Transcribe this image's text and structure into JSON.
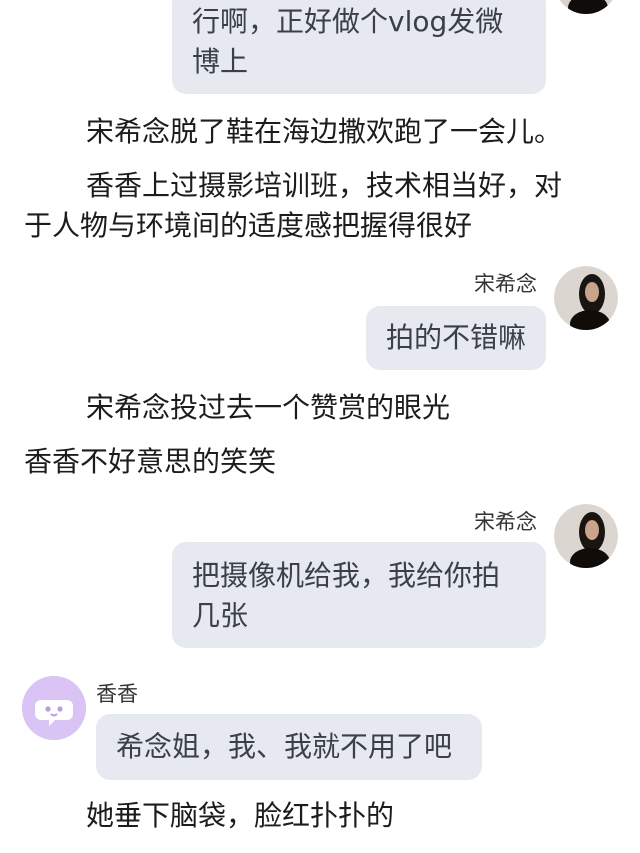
{
  "messages": {
    "m1_text": "行啊，正好做个vlog发微博上",
    "m2_name": "宋希念",
    "m2_text": "拍的不错嘛",
    "m3_name": "宋希念",
    "m3_text": "把摄像机给我，我给你拍几张",
    "m4_name": "香香",
    "m4_text": "希念姐，我、我就不用了吧"
  },
  "narration": {
    "n1": "宋希念脱了鞋在海边撒欢跑了一会儿。",
    "n2a": "香香上过摄影培训班，技术相当好，对",
    "n2b": "于人物与环境间的适度感把握得很好",
    "n3": "宋希念投过去一个赞赏的眼光",
    "n4": "香香不好意思的笑笑",
    "n5": "她垂下脑袋，脸红扑扑的"
  },
  "avatars": {
    "song_avatar_icon": "photo-avatar",
    "xiang_avatar_icon": "chat-bubble-face-icon",
    "xiang_avatar_color": "#d9c4f5"
  }
}
